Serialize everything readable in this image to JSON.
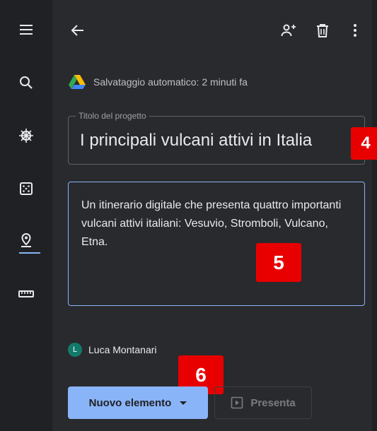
{
  "rail": {
    "items": [
      {
        "icon": "menu-icon"
      },
      {
        "icon": "search-icon"
      },
      {
        "icon": "ship-wheel-icon"
      },
      {
        "icon": "dice-icon"
      },
      {
        "icon": "map-pin-icon",
        "active": true
      },
      {
        "icon": "ruler-icon"
      }
    ],
    "active_color": "#8ab4f8"
  },
  "toolbar": {
    "back_icon": "arrow-back-icon",
    "share_icon": "add-person-icon",
    "delete_icon": "trash-icon",
    "more_icon": "more-vert-icon"
  },
  "autosave": {
    "icon": "google-drive-icon",
    "text": "Salvataggio automatico: 2 minuti fa"
  },
  "project": {
    "title_label": "Titolo del progetto",
    "title_value": "I principali vulcani attivi in Italia",
    "description": "Un itinerario digitale che presenta quattro importanti vulcani attivi italiani: Vesuvio, Stromboli, Vulcano, Etna."
  },
  "owner": {
    "initial": "L",
    "name": "Luca Montanari"
  },
  "actions": {
    "new_item": "Nuovo elemento",
    "present": "Presenta"
  },
  "annotations": {
    "badge_title": "4",
    "badge_description": "5",
    "badge_new_item": "6"
  },
  "colors": {
    "accent": "#8ab4f8",
    "badge": "#e80000",
    "avatar": "#137a6b"
  }
}
